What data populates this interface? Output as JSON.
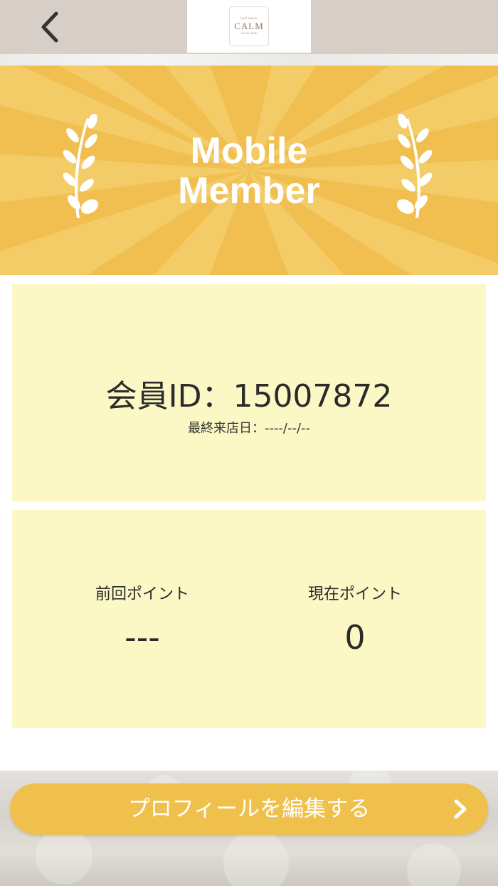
{
  "header": {
    "back_icon": "chevron-left-icon",
    "logo": {
      "small_top": "nail salon",
      "name": "CALM",
      "small_bottom": "nails bar"
    }
  },
  "banner": {
    "title_line1": "Mobile",
    "title_line2": "Member",
    "background_color": "#f0bf4f",
    "ray_color": "#f4cf6f",
    "left_icon": "laurel-branch-icon",
    "right_icon": "laurel-branch-icon"
  },
  "member": {
    "id_text": "会員ID：15007872",
    "last_visit_text": "最終来店日：----/--/--"
  },
  "points": {
    "previous_label": "前回ポイント",
    "previous_value": "---",
    "current_label": "現在ポイント",
    "current_value": "0"
  },
  "footer": {
    "edit_profile_label": "プロフィールを編集する",
    "chevron_icon": "chevron-right-icon",
    "button_color": "#f0c04d"
  },
  "colors": {
    "header_bg": "#d7cfc7",
    "card_bg": "#fcf8c6"
  }
}
